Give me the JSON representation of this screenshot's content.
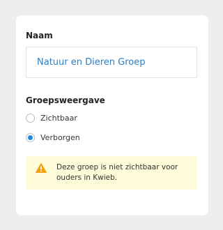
{
  "group_name": {
    "label": "Naam",
    "value": "Natuur en Dieren Groep"
  },
  "group_visibility": {
    "label": "Groepsweergave",
    "options": [
      {
        "label": "Zichtbaar",
        "selected": false
      },
      {
        "label": "Verborgen",
        "selected": true
      }
    ]
  },
  "warning": {
    "icon": "warning-icon",
    "text": "Deze groep is niet zichtbaar voor ouders in Kwieb."
  },
  "colors": {
    "accent": "#1e88e5",
    "value_text": "#2c7fc4",
    "warning_background": "#fefcd9",
    "warning_icon": "#f0a20a"
  }
}
